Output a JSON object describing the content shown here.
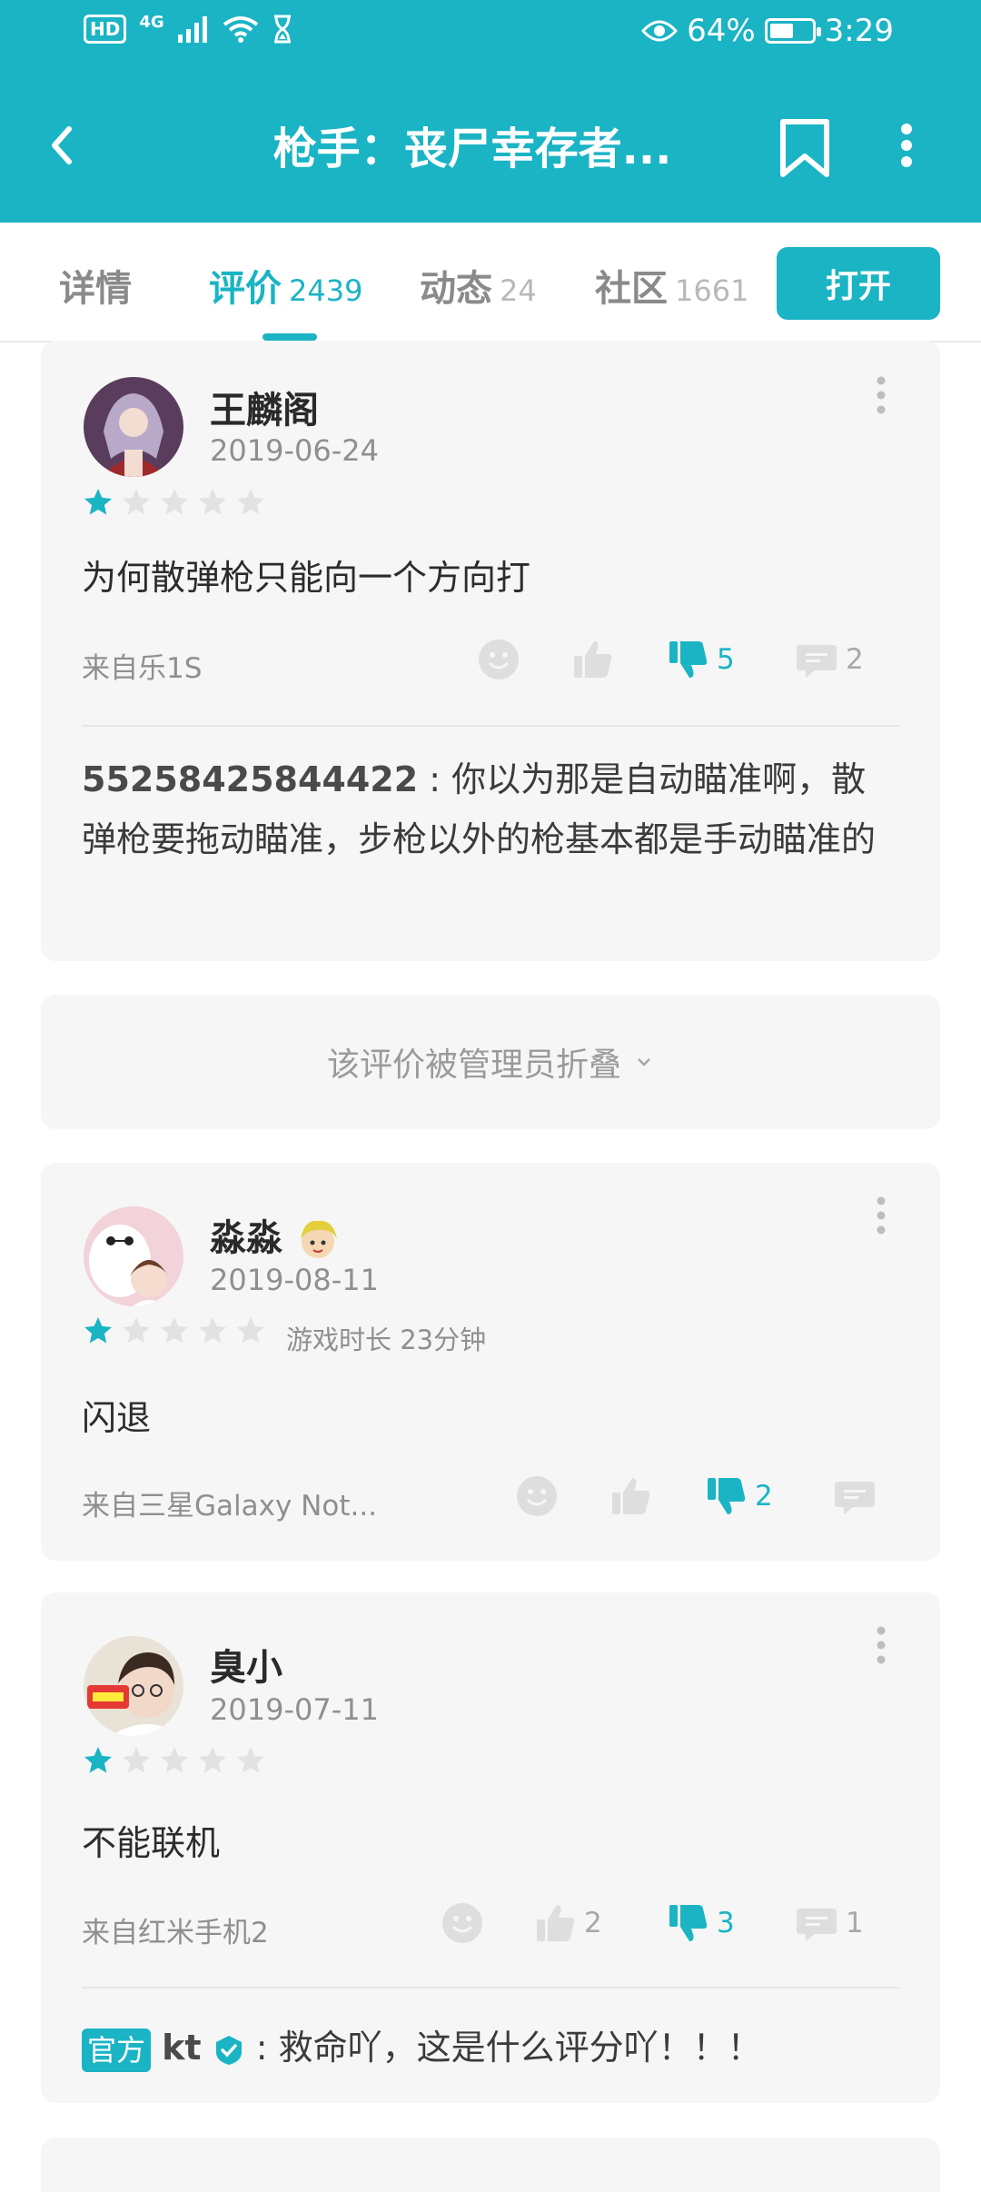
{
  "status_bar": {
    "hd": "HD",
    "network": "4G",
    "battery_percent": "64%",
    "battery_level": 0.64,
    "time": "3:29"
  },
  "header": {
    "title": "枪手：丧尸幸存者...",
    "back_icon": "back-arrow-icon",
    "bookmark_icon": "bookmark-icon",
    "more_icon": "more-vertical-icon"
  },
  "tabs": [
    {
      "label": "详情",
      "count": ""
    },
    {
      "label": "评价",
      "count": "2439",
      "active": true
    },
    {
      "label": "动态",
      "count": "24"
    },
    {
      "label": "社区",
      "count": "1661"
    }
  ],
  "open_button": "打开",
  "colors": {
    "accent": "#1ab4c4",
    "card_bg": "#f6f6f6"
  },
  "reviews": [
    {
      "username": "王麟阁",
      "date": "2019-06-24",
      "rating": 1,
      "text": "为何散弹枪只能向一个方向打",
      "source": "来自乐1S",
      "likes": "",
      "dislikes": "5",
      "comments": "2",
      "reply": {
        "user": "55258425844422",
        "separator": " : ",
        "text": "你以为那是自动瞄准啊，散弹枪要拖动瞄准，步枪以外的枪基本都是手动瞄准的"
      }
    },
    {
      "username": "淼淼",
      "date": "2019-08-11",
      "rating": 1,
      "playtime": "游戏时长 23分钟",
      "text": "闪退",
      "source": "来自三星Galaxy Not...",
      "likes": "",
      "dislikes": "2",
      "comments": ""
    },
    {
      "username": "臭小",
      "date": "2019-07-11",
      "rating": 1,
      "text": "不能联机",
      "source": "来自红米手机2",
      "likes": "2",
      "dislikes": "3",
      "comments": "1",
      "reply": {
        "badge": "官方",
        "user": "kt",
        "separator": " : ",
        "text": "救命吖，这是什么评分吖！！！"
      }
    }
  ],
  "collapsed_notice": "该评价被管理员折叠"
}
